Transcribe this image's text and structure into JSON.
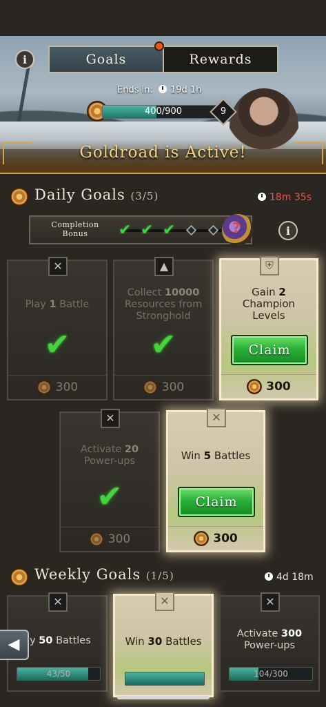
{
  "header": {
    "tabs": [
      {
        "label": "Goals",
        "active": true
      },
      {
        "label": "Rewards",
        "active": false
      }
    ],
    "ends_label": "Ends in:",
    "ends_value": "19d 1h",
    "progress_text": "400/900",
    "progress_fraction": 0.444,
    "level": "9",
    "banner_text": "Goldroad is Active!"
  },
  "daily": {
    "title": "Daily Goals",
    "count": "(3/5)",
    "timer": "18m 35s",
    "bonus_label_line1": "Completion",
    "bonus_label_line2": "Bonus",
    "bonus_completed": 3,
    "bonus_total": 5,
    "cards": [
      {
        "pre": "Play ",
        "num": "1",
        "post": " Battle",
        "reward": "300",
        "state": "done",
        "icon": "crossed-swords-icon"
      },
      {
        "pre": "Collect ",
        "num": "10000",
        "post": " Resources from Stronghold",
        "reward": "300",
        "state": "done",
        "icon": "resource-icon"
      },
      {
        "pre": "Gain ",
        "num": "2",
        "post": " Champion Levels",
        "reward": "300",
        "state": "claim",
        "icon": "helmet-icon"
      },
      {
        "pre": "Activate ",
        "num": "20",
        "post": " Power-ups",
        "reward": "300",
        "state": "done",
        "icon": "crossed-swords-icon"
      },
      {
        "pre": "Win ",
        "num": "5",
        "post": " Battles",
        "reward": "300",
        "state": "claim",
        "icon": "crossed-swords-icon"
      }
    ],
    "claim_label": "Claim"
  },
  "weekly": {
    "title": "Weekly Goals",
    "count": "(1/5)",
    "timer": "4d 18m",
    "cards": [
      {
        "pre": "ay ",
        "num": "50",
        "post": " Battles",
        "progress": "43/50",
        "progress_fraction": 0.86
      },
      {
        "pre": "Win ",
        "num": "30",
        "post": " Battles",
        "progress": "",
        "progress_fraction": 1.0
      },
      {
        "pre": "Activate ",
        "num": "300",
        "post": " Power-ups",
        "progress": "104/300",
        "progress_fraction": 0.35
      }
    ]
  },
  "icons": {
    "info": "i",
    "check": "✔",
    "swords": "✕",
    "back_arrow": "◀"
  },
  "colors": {
    "accent_gold": "#d2a545",
    "timer_red": "#e8554b",
    "claim_green": "#2bb03a"
  }
}
